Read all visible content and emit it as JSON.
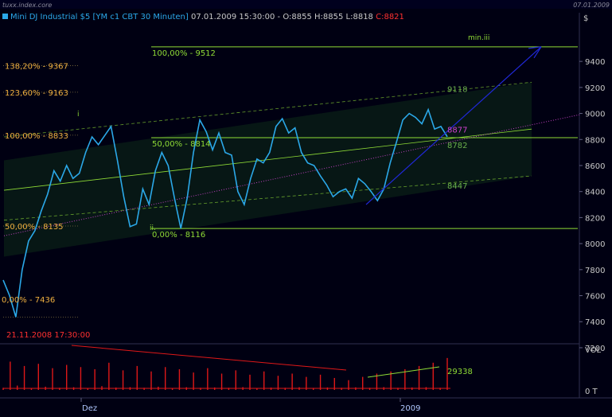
{
  "window": {
    "title_left": "tuxx.index.core",
    "title_right": "07.01.2009",
    "currency_symbol": "$"
  },
  "header": {
    "symbol": "Mini DJ Industrial $5 [YM c1 CBT  30 Minuten]",
    "bar_time": "07.01.2009 15:30:00",
    "ohlc": "- O:8855 H:8855 L:8818",
    "close": "C:8821"
  },
  "colors": {
    "background": "#000012",
    "price_line": "#2ba8e8",
    "support_line": "#8fdc36",
    "fib_label": "#f0b040",
    "channel_label": "#8fdc36",
    "volume": "#e01818",
    "volume_trend_down": "#e01818",
    "volume_trend_up": "#8fdc36",
    "wave_arrow": "#2028d8",
    "dotted_trend": "#c040c0",
    "close_text": "#ff3030",
    "axis_text": "#c8c8c8",
    "date_text": "#b0c8ff"
  },
  "chart_data": [
    {
      "type": "line",
      "title": "Mini DJ Industrial $5 [YM c1 CBT  30 Minuten]",
      "y_ticks": [
        9400,
        9200,
        9000,
        8800,
        8600,
        8400,
        8200,
        8000,
        7800,
        7600,
        7400,
        7200
      ],
      "ylim": [
        7130,
        9570
      ],
      "x_ticks": [
        "Dez",
        "2009"
      ],
      "series": [
        {
          "values": [
            7720,
            7600,
            7436,
            7800,
            8020,
            8100,
            8250,
            8380,
            8560,
            8480,
            8600,
            8500,
            8540,
            8700,
            8820,
            8760,
            8830,
            8900,
            8640,
            8360,
            8130,
            8150,
            8420,
            8300,
            8560,
            8700,
            8600,
            8350,
            8116,
            8350,
            8700,
            8950,
            8860,
            8720,
            8850,
            8700,
            8680,
            8400,
            8300,
            8500,
            8650,
            8620,
            8700,
            8900,
            8960,
            8850,
            8890,
            8700,
            8620,
            8600,
            8520,
            8450,
            8360,
            8400,
            8420,
            8350,
            8500,
            8460,
            8400,
            8330,
            8420,
            8620,
            8780,
            8950,
            9000,
            8970,
            8920,
            9030,
            8880,
            8900,
            8821
          ]
        }
      ],
      "fib_levels": [
        {
          "label": "138,20% - 9367",
          "value": 9367
        },
        {
          "label": "123,60% - 9163",
          "value": 9163
        },
        {
          "label": "100,00% - 8833",
          "value": 8833
        },
        {
          "label": "50,00% - 8135",
          "value": 8135
        },
        {
          "label": "0,00% - 7436",
          "value": 7436
        }
      ],
      "wave_levels": [
        {
          "label": "100,00% - 9512",
          "value": 9512
        },
        {
          "label": "50,00% - 8814",
          "value": 8814
        },
        {
          "label": "0,00% - 8116",
          "value": 8116
        }
      ],
      "channel_values": [
        {
          "label": "9118",
          "value": 9118
        },
        {
          "label": "8782",
          "value": 8782
        },
        {
          "label": "8447",
          "value": 8447
        }
      ],
      "last_value": {
        "label": "8877",
        "value": 8877
      },
      "target_label": "min.iii",
      "wave_labels": [
        "i",
        "ii."
      ],
      "annotation_date": "21.11.2008 17:30:00"
    },
    {
      "type": "bar",
      "ylabel": "VOL",
      "y_ticks_labels": [
        "0 T"
      ],
      "last_value_label": "29338",
      "last_value": 29338,
      "ylim": [
        0,
        38000
      ],
      "values": [
        2000,
        26000,
        4000,
        22000,
        1500,
        24000,
        3000,
        20000,
        2000,
        23000,
        2500,
        21000,
        1800,
        19000,
        3500,
        25000,
        2200,
        18000,
        2600,
        22000,
        2000,
        17000,
        3000,
        21000,
        1800,
        19000,
        2500,
        16000,
        2000,
        20000,
        2300,
        15000,
        2000,
        18000,
        2600,
        14000,
        1800,
        17000,
        2200,
        13000,
        2000,
        15000,
        2500,
        12000,
        1900,
        14000,
        2300,
        11000,
        2000,
        9000,
        2400,
        12000,
        2000,
        15000,
        2600,
        17000,
        2000,
        19000,
        2300,
        22000,
        2600,
        25000,
        2000,
        29338
      ]
    }
  ]
}
